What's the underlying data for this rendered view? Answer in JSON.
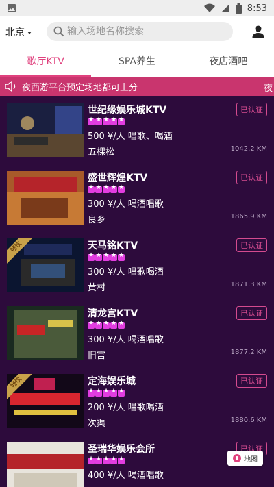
{
  "status_bar": {
    "time": "8:53",
    "icons": [
      "image-icon",
      "wifi-icon",
      "signal-icon",
      "battery-icon"
    ]
  },
  "header": {
    "city": "北京",
    "search_placeholder": "输入场地名称搜索",
    "icons": {
      "search": "search-icon",
      "user": "user-icon",
      "city_caret": "chevron-down-icon"
    }
  },
  "tabs": [
    {
      "label": "歌厅KTV",
      "active": true
    },
    {
      "label": "SPA养生",
      "active": false
    },
    {
      "label": "夜店酒吧",
      "active": false
    }
  ],
  "notice": {
    "text": "夜西游平台预定场地都可上分",
    "tail": "夜"
  },
  "venues": [
    {
      "name": "世纪缘娱乐城KTV",
      "rating": 5,
      "price": "500 ¥/人 唱歌、喝酒",
      "area": "五棵松",
      "distance": "1042.2 KM",
      "badge": "已认证",
      "ribbon": ""
    },
    {
      "name": "盛世辉煌KTV",
      "rating": 5,
      "price": "300 ¥/人 喝酒唱歌",
      "area": "良乡",
      "distance": "1865.9 KM",
      "badge": "已认证",
      "ribbon": ""
    },
    {
      "name": "天马铭KTV",
      "rating": 5,
      "price": "300 ¥/人 唱歌喝酒",
      "area": "黄村",
      "distance": "1871.3 KM",
      "badge": "已认证",
      "ribbon": "畅饮"
    },
    {
      "name": "清龙宫KTV",
      "rating": 5,
      "price": "300 ¥/人 喝酒唱歌",
      "area": "旧宫",
      "distance": "1877.2 KM",
      "badge": "已认证",
      "ribbon": ""
    },
    {
      "name": "定海娱乐城",
      "rating": 5,
      "price": "200 ¥/人 唱歌喝酒",
      "area": "次渠",
      "distance": "1880.6 KM",
      "badge": "已认证",
      "ribbon": "畅饮"
    },
    {
      "name": "圣瑞华娱乐会所",
      "rating": 5,
      "price": "400 ¥/人 喝酒唱歌",
      "area": "",
      "distance": "",
      "badge": "已认证",
      "ribbon": ""
    }
  ],
  "map_button": {
    "label": "地图"
  },
  "colors": {
    "accent": "#e0427e",
    "notice_bg": "#c9356e",
    "list_bg": "#2d0b3c",
    "star": "#e23de0"
  }
}
